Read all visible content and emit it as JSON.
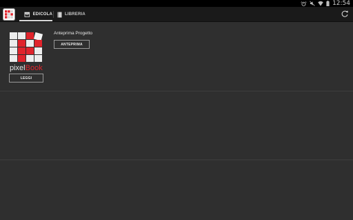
{
  "status_bar": {
    "time": "12:54",
    "icons": [
      "alarm-icon",
      "mute-icon",
      "wifi-icon",
      "battery-icon"
    ]
  },
  "action_bar": {
    "app_icon": "pixelbook-app-icon",
    "tabs": [
      {
        "label": "EDICOLA",
        "icon": "newsstand-icon",
        "selected": true
      },
      {
        "label": "LIBRERIA",
        "icon": "book-icon",
        "selected": false
      }
    ],
    "refresh_icon": "refresh-icon"
  },
  "items": [
    {
      "logo_text_main": "pixel",
      "logo_text_accent": "Book",
      "read_button": "LEGGI",
      "title": "Anteprima Progetto",
      "preview_button": "ANTEPRIMA"
    }
  ],
  "colors": {
    "background": "#2f2f2f",
    "action_bar": "#1a1a1a",
    "brand_red": "#e0242c"
  }
}
